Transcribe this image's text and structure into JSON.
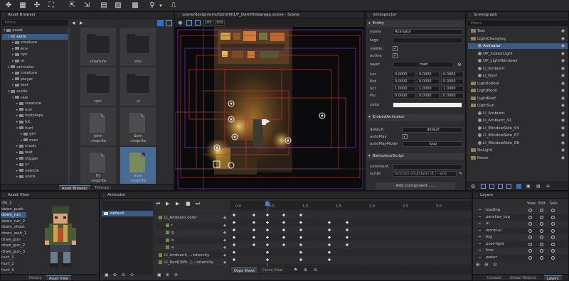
{
  "toolbar": {
    "icons": [
      "move-icon",
      "grid-select-icon",
      "transform-icon",
      "fullscreen-icon",
      "export-icon",
      "import-icon",
      "image-icon",
      "location-pin-icon",
      "chevron-down-icon",
      "settings-icon"
    ]
  },
  "asset_browser": {
    "title": "Asset Browser",
    "filter_placeholder": "Filters",
    "tree": [
      {
        "label": "asset",
        "depth": 0,
        "expanded": true
      },
      {
        "label": "anim",
        "depth": 1,
        "selected": true,
        "expanded": true
      },
      {
        "label": "creature",
        "depth": 2
      },
      {
        "label": "env",
        "depth": 2
      },
      {
        "label": "npc",
        "depth": 2
      },
      {
        "label": "ui",
        "depth": 2
      },
      {
        "label": "animator",
        "depth": 1,
        "expanded": true
      },
      {
        "label": "creature",
        "depth": 2
      },
      {
        "label": "player",
        "depth": 2
      },
      {
        "label": "test",
        "depth": 2
      },
      {
        "label": "audio",
        "depth": 1,
        "expanded": true
      },
      {
        "label": "raw",
        "depth": 2,
        "expanded": true
      },
      {
        "label": "creature",
        "depth": 3
      },
      {
        "label": "env",
        "depth": 3
      },
      {
        "label": "footsteps",
        "depth": 3
      },
      {
        "label": "hit",
        "depth": 3
      },
      {
        "label": "hurt",
        "depth": 3,
        "expanded": true
      },
      {
        "label": "girl",
        "depth": 4
      },
      {
        "label": "man",
        "depth": 4
      },
      {
        "label": "music",
        "depth": 3
      },
      {
        "label": "test",
        "depth": 3
      },
      {
        "label": "trigger",
        "depth": 3
      },
      {
        "label": "ui",
        "depth": 3
      },
      {
        "label": "vehicle",
        "depth": 3
      },
      {
        "label": "voice",
        "depth": 3
      }
    ],
    "tiles": [
      {
        "label": "creature",
        "kind": "folder"
      },
      {
        "label": "env",
        "kind": "folder"
      },
      {
        "label": "npc",
        "kind": "folder"
      },
      {
        "label": "ui",
        "kind": "folder"
      },
      {
        "label": "John\n.msprite",
        "kind": "doc"
      },
      {
        "label": "Sam\n.msprite",
        "kind": "doc"
      },
      {
        "label": "fly\n.msprite",
        "kind": "doc"
      },
      {
        "label": "man\n.msprite",
        "kind": "doc",
        "selected": true
      }
    ],
    "tabs": [
      "Asset Browser",
      "Tilemap"
    ]
  },
  "scene": {
    "title": "scene/design/env/DemHill1/F_DemHillGarage.scene - Scene",
    "zoom_a": "100",
    "zoom_b": "100"
  },
  "introspector": {
    "title": "Introspector",
    "entity_header": "Entity",
    "name_label": "name",
    "name_value": "Animator",
    "tags_label": "tags",
    "visible_label": "visible",
    "active_label": "active",
    "layer_label": "layer",
    "layer_value": "main",
    "loc_label": "Loc",
    "rot_label": "Rot",
    "scl_label": "Scl",
    "piv_label": "Piv",
    "loc": [
      "0.0000",
      "0.0000",
      "0.0000"
    ],
    "rot": [
      "0.0000",
      "0.0000",
      "0.0000"
    ],
    "scl": [
      "1.0000",
      "1.0000",
      "1.0000"
    ],
    "piv": [
      "0.0000",
      "0.0000",
      "0.0000"
    ],
    "color_label": "color",
    "embed_header": "EmbedAnimator",
    "default_label": "default",
    "default_value": "default",
    "autoplay_label": "autoPlay",
    "autoplaymode_label": "autoPlayMode",
    "autoplaymode_value": "loop",
    "behaviour_header": "BehaviourScript",
    "comment_label": "comment",
    "script_label": "script",
    "script_value": "function onUpdate( dt ) --end",
    "add_component": "Add Component ....."
  },
  "scenegraph": {
    "title": "Scenegraph",
    "filter_placeholder": "Filters",
    "items": [
      {
        "label": "Test",
        "depth": 0,
        "kind": "folder"
      },
      {
        "label": "LightChanging",
        "depth": 0,
        "kind": "folder",
        "expanded": true
      },
      {
        "label": "Animator",
        "depth": 1,
        "kind": "item",
        "selected": true
      },
      {
        "label": "OP_IndoorLight",
        "depth": 1,
        "kind": "item"
      },
      {
        "label": "OP_LightWindows",
        "depth": 1,
        "kind": "item"
      },
      {
        "label": "LI_Ambient",
        "depth": 1,
        "kind": "item"
      },
      {
        "label": "LI_Roof",
        "depth": 1,
        "kind": "item"
      },
      {
        "label": "LightIndoor",
        "depth": 0,
        "kind": "folder"
      },
      {
        "label": "LightNoon",
        "depth": 0,
        "kind": "folder"
      },
      {
        "label": "LightRoof",
        "depth": 0,
        "kind": "folder"
      },
      {
        "label": "LightSun",
        "depth": 0,
        "kind": "folder",
        "expanded": true
      },
      {
        "label": "LI_Ambient",
        "depth": 1,
        "kind": "item"
      },
      {
        "label": "LI_Ambient_01",
        "depth": 1,
        "kind": "item"
      },
      {
        "label": "LI_WindowSide_04",
        "depth": 1,
        "kind": "item"
      },
      {
        "label": "LI_WindowSide_07",
        "depth": 1,
        "kind": "item"
      },
      {
        "label": "LI_WindowSide_08",
        "depth": 1,
        "kind": "item"
      },
      {
        "label": "NoLight",
        "depth": 0,
        "kind": "folder"
      },
      {
        "label": "Room",
        "depth": 0,
        "kind": "folder"
      }
    ]
  },
  "asset_view": {
    "title": "Asset View",
    "clips": [
      "die_1",
      "down_push",
      "down_run",
      "down_run_2",
      "down_shoot",
      "down_wait_1",
      "draw_gun",
      "draw_gun_2",
      "draw_gun_3",
      "hurt_1",
      "hurt_2",
      "hurt_3"
    ],
    "tabs": [
      "History",
      "Asset View"
    ]
  },
  "animator": {
    "title": "Animator",
    "clip_list": [
      "default"
    ],
    "tracks": [
      {
        "label": "Li_Ambient.color",
        "depth": 0
      },
      {
        "label": "r",
        "depth": 1
      },
      {
        "label": "g",
        "depth": 1
      },
      {
        "label": "b",
        "depth": 1
      },
      {
        "label": "a",
        "depth": 1
      },
      {
        "label": "LI_Ambient\\...:intensity",
        "depth": 0
      },
      {
        "label": "LI_Roof[\\Wh..]...:intensity",
        "depth": 0
      }
    ],
    "ruler": [
      "0.0",
      "0.5",
      "1.0",
      "1.5",
      "2.0",
      "2.5",
      "3.0"
    ],
    "tabs": [
      "Dope Sheet",
      "Curve View"
    ]
  },
  "layers": {
    "title": "Layers",
    "columns": [
      "View",
      "Edit",
      "Solo"
    ],
    "items": [
      "loading",
      "parallax_top",
      "ui",
      "world-ui",
      "fog",
      "post-light",
      "fore",
      "water"
    ],
    "tabs": [
      "Console",
      "Global Objects",
      "Layers"
    ]
  }
}
